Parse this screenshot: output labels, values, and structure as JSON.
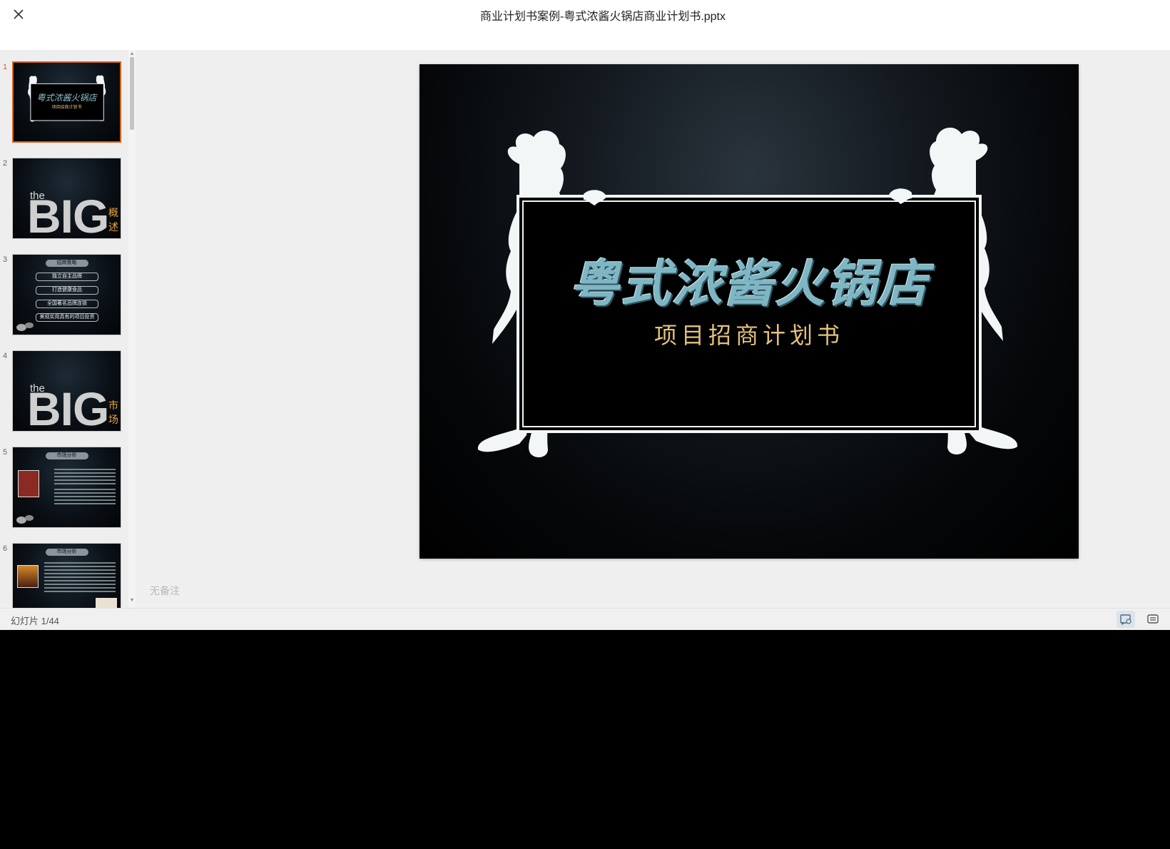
{
  "header": {
    "title": "商业计划书案例-粤式浓酱火锅店商业计划书.pptx",
    "close_icon": "close-icon"
  },
  "sidebar": {
    "thumbnails": [
      {
        "number": "1",
        "title": "粤式浓酱火锅店",
        "subtitle": "项目招商计划书",
        "active": true
      },
      {
        "number": "2",
        "the": "the",
        "big": "BIG",
        "side": "概述"
      },
      {
        "number": "3",
        "pill": "招商策略",
        "items": [
          "独立自主品牌",
          "打造健康食品",
          "全国著名品牌连锁",
          "美观实用具有的项目投资"
        ]
      },
      {
        "number": "4",
        "the": "the",
        "big": "BIG",
        "side": "市场"
      },
      {
        "number": "5",
        "pill": "市场分析"
      },
      {
        "number": "6",
        "pill": "市场分析"
      }
    ]
  },
  "slide": {
    "title": "粤式浓酱火锅店",
    "subtitle": "项目招商计划书"
  },
  "notes": "无备注",
  "status": {
    "slide_counter": "幻灯片 1/44",
    "view_notes_icon": "notes-view-icon",
    "view_comments_icon": "comments-view-icon"
  },
  "colors": {
    "accent": "#d4621e",
    "title_teal": "#7fb6c4",
    "subtitle_gold": "#e4c27a"
  }
}
